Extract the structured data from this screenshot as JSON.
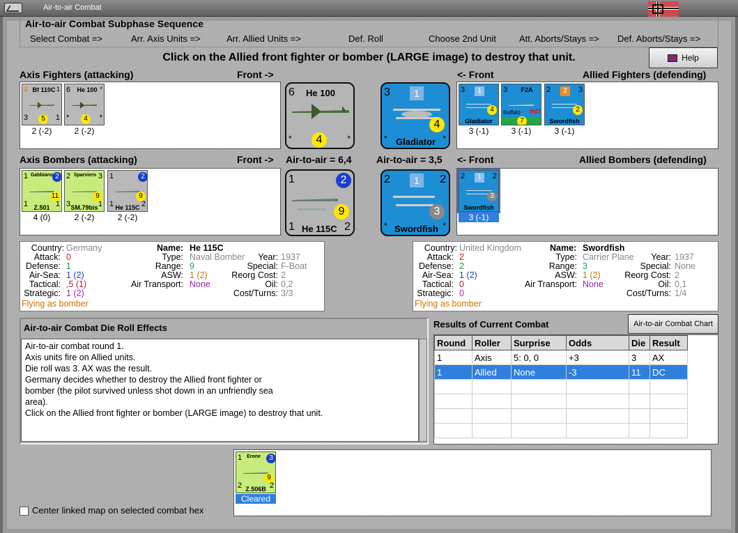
{
  "window": {
    "title": "Air-to-air Combat"
  },
  "phase": {
    "header": "Air-to-air Combat Subphase Sequence",
    "steps": [
      "Select Combat =>",
      "Arr. Axis Units =>",
      "Arr. Allied Units =>",
      "Def. Roll",
      "Choose 2nd Unit",
      "Att. Aborts/Stays =>",
      "Def. Aborts/Stays =>"
    ]
  },
  "instruction": "Click on the Allied front fighter or bomber (LARGE image) to destroy that unit.",
  "help_label": "Help",
  "sections": {
    "axis_fighters": "Axis Fighters (attacking)",
    "axis_front1": "Front ->",
    "allied_front1": "<- Front",
    "allied_fighters": "Allied Fighters (defending)",
    "axis_bombers": "Axis Bombers (attacking)",
    "axis_front2": "Front ->",
    "axis_air_to_air": "Air-to-air = 6,4",
    "allied_air_to_air": "Air-to-air = 3,5",
    "allied_front2": "<- Front",
    "allied_bombers": "Allied Bombers (defending)"
  },
  "axis_fighters": [
    {
      "name": "Bf 110C",
      "tl": "4",
      "tr": "1",
      "bl": "3",
      "br": "1",
      "circle": "5",
      "label": "2 (-2)"
    },
    {
      "name": "He 100",
      "tl": "6",
      "tr": "*",
      "bl": "*",
      "br": "*",
      "circle": "4",
      "label": "2 (-2)"
    }
  ],
  "axis_front_fighter": {
    "name": "He 100",
    "tl": "6",
    "bl": "*",
    "br": "*",
    "circle": "4"
  },
  "allied_front_fighter": {
    "name": "Gladiator",
    "tl": "3",
    "square": "1",
    "bl": "*",
    "br": "*",
    "circle": "4"
  },
  "allied_fighters": [
    {
      "name": "Gladiator",
      "tl": "3",
      "square": "1",
      "circle": "4",
      "label": "3 (-1)"
    },
    {
      "name": "F2A",
      "tl": "3",
      "sub": "Buffalo",
      "tag": "IND",
      "circle": "7",
      "label": "3 (-1)"
    },
    {
      "name": "Swordfish",
      "tl": "2",
      "square": "2",
      "tr": "3",
      "circle": "2",
      "label": "3 (-1)"
    }
  ],
  "axis_bombers": [
    {
      "name": "Gabbiano",
      "model": "Z.501",
      "tl": "1",
      "circle": "11",
      "circle2": "2",
      "bl": "1",
      "br": "1",
      "label": "4 (0)"
    },
    {
      "name": "Sparviero",
      "model": "SM.79bis",
      "tl": "2",
      "tr": "3",
      "circle": "9",
      "bl": "3",
      "br": "1",
      "label": "2 (-2)"
    },
    {
      "name": "He 115C",
      "tl": "1",
      "circle": "9",
      "circle2": "2",
      "bl": "1",
      "br": "2",
      "label": "2 (-2)"
    }
  ],
  "axis_front_bomber": {
    "name": "He 115C",
    "tl": "1",
    "circle2": "2",
    "circle": "9",
    "bl": "1",
    "br": "2"
  },
  "allied_front_bomber": {
    "name": "Swordfish",
    "tl": "2",
    "square": "1",
    "tr": "2",
    "circle": "3",
    "bl": "*",
    "br": "*"
  },
  "allied_bombers": [
    {
      "name": "Swordfish",
      "tl": "2",
      "square": "1",
      "tr": "2",
      "circle": "3",
      "label": "3 (-1)"
    }
  ],
  "axis_info": {
    "country_label": "Country:",
    "country": "Germany",
    "attack_label": "Attack:",
    "attack": "0",
    "defense_label": "Defense:",
    "defense": "1",
    "airsea_label": "Air-Sea:",
    "airsea": "1 (2)",
    "tactical_label": "Tactical:",
    "tactical": ",5 (1)",
    "strategic_label": "Strategic:",
    "strategic": "1 (2)",
    "flying": "Flying as bomber",
    "name_label": "Name:",
    "name": "He 115C",
    "type_label": "Type:",
    "type": "Naval Bomber",
    "range_label": "Range:",
    "range": "9",
    "asw_label": "ASW:",
    "asw": "1 (2)",
    "transport_label": "Air Transport:",
    "transport": "None",
    "year_label": "Year:",
    "year": "1937",
    "special_label": "Special:",
    "special": "F-Boat",
    "reorg_label": "Reorg Cost:",
    "reorg": "2",
    "oil_label": "Oil:",
    "oil": "0,2",
    "cost_label": "Cost/Turns:",
    "cost": "3/3"
  },
  "allied_info": {
    "country_label": "Country:",
    "country": "United Kingdom",
    "attack_label": "Attack:",
    "attack": "2",
    "defense_label": "Defense:",
    "defense": "2",
    "airsea_label": "Air-Sea:",
    "airsea": "1 (2)",
    "tactical_label": "Tactical:",
    "tactical": "0",
    "strategic_label": "Strategic:",
    "strategic": "0",
    "flying": "Flying as bomber",
    "name_label": "Name:",
    "name": "Swordfish",
    "type_label": "Type:",
    "type": "Carrier Plane",
    "range_label": "Range:",
    "range": "3",
    "asw_label": "ASW:",
    "asw": "1 (2)",
    "transport_label": "Air Transport:",
    "transport": "None",
    "year_label": "Year:",
    "year": "1937",
    "special_label": "Special:",
    "special": "None",
    "reorg_label": "Reorg Cost:",
    "reorg": "2",
    "oil_label": "Oil:",
    "oil": "0,1",
    "cost_label": "Cost/Turns:",
    "cost": "1/4"
  },
  "die_roll": {
    "title": "Air-to-air Combat Die Roll Effects",
    "lines": [
      "Air-to-air combat round 1.",
      "Axis units fire on Allied units.",
      "Die roll was 3.  AX was the result.",
      "Germany decides whether to destroy the Allied front fighter or",
      "bomber (the pilot survived unless shot down in an unfriendly sea",
      "area).",
      "Click on the Allied front fighter or bomber (LARGE image) to destroy that unit."
    ]
  },
  "results": {
    "title": "Results of Current Combat",
    "chart_button": "Air-to-air Combat Chart",
    "headers": [
      "Round",
      "Roller",
      "Surprise",
      "Odds",
      "Die",
      "Result"
    ],
    "rows": [
      [
        "1",
        "Axis",
        "5: 0, 0",
        "+3",
        "3",
        "AX"
      ],
      [
        "1",
        "Allied",
        "None",
        "-3",
        "11",
        "DC"
      ]
    ]
  },
  "bottom_unit": {
    "name": "Erone",
    "model": "Z.506B",
    "tl": "1",
    "circle2": "3",
    "circle": "9",
    "bl": "2",
    "br": "2",
    "label": "Cleared"
  },
  "checkbox_label": "Center linked map on selected combat hex"
}
